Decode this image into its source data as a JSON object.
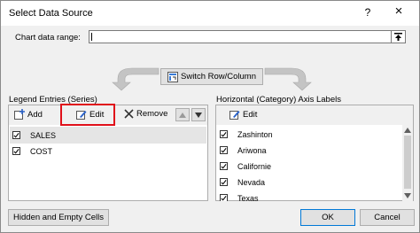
{
  "dialog": {
    "title": "Select Data Source",
    "help": "?",
    "close": "×"
  },
  "range": {
    "label": "Chart data range:",
    "value": ""
  },
  "switch_button": "Switch Row/Column",
  "legend": {
    "header": "Legend Entries (Series)",
    "add": "Add",
    "edit": "Edit",
    "remove": "Remove",
    "items": [
      {
        "label": "SALES",
        "checked": true
      },
      {
        "label": "COST",
        "checked": true
      }
    ]
  },
  "axis": {
    "header": "Horizontal (Category) Axis Labels",
    "edit": "Edit",
    "items": [
      {
        "label": "Zashinton",
        "checked": true
      },
      {
        "label": "Ariwona",
        "checked": true
      },
      {
        "label": "Californie",
        "checked": true
      },
      {
        "label": "Nevada",
        "checked": true
      },
      {
        "label": "Texas",
        "checked": true
      }
    ]
  },
  "footer": {
    "hidden_cells": "Hidden and Empty Cells",
    "ok": "OK",
    "cancel": "Cancel"
  },
  "colors": {
    "highlight": "#e0101a",
    "selected_row": "#e5e5e5"
  }
}
